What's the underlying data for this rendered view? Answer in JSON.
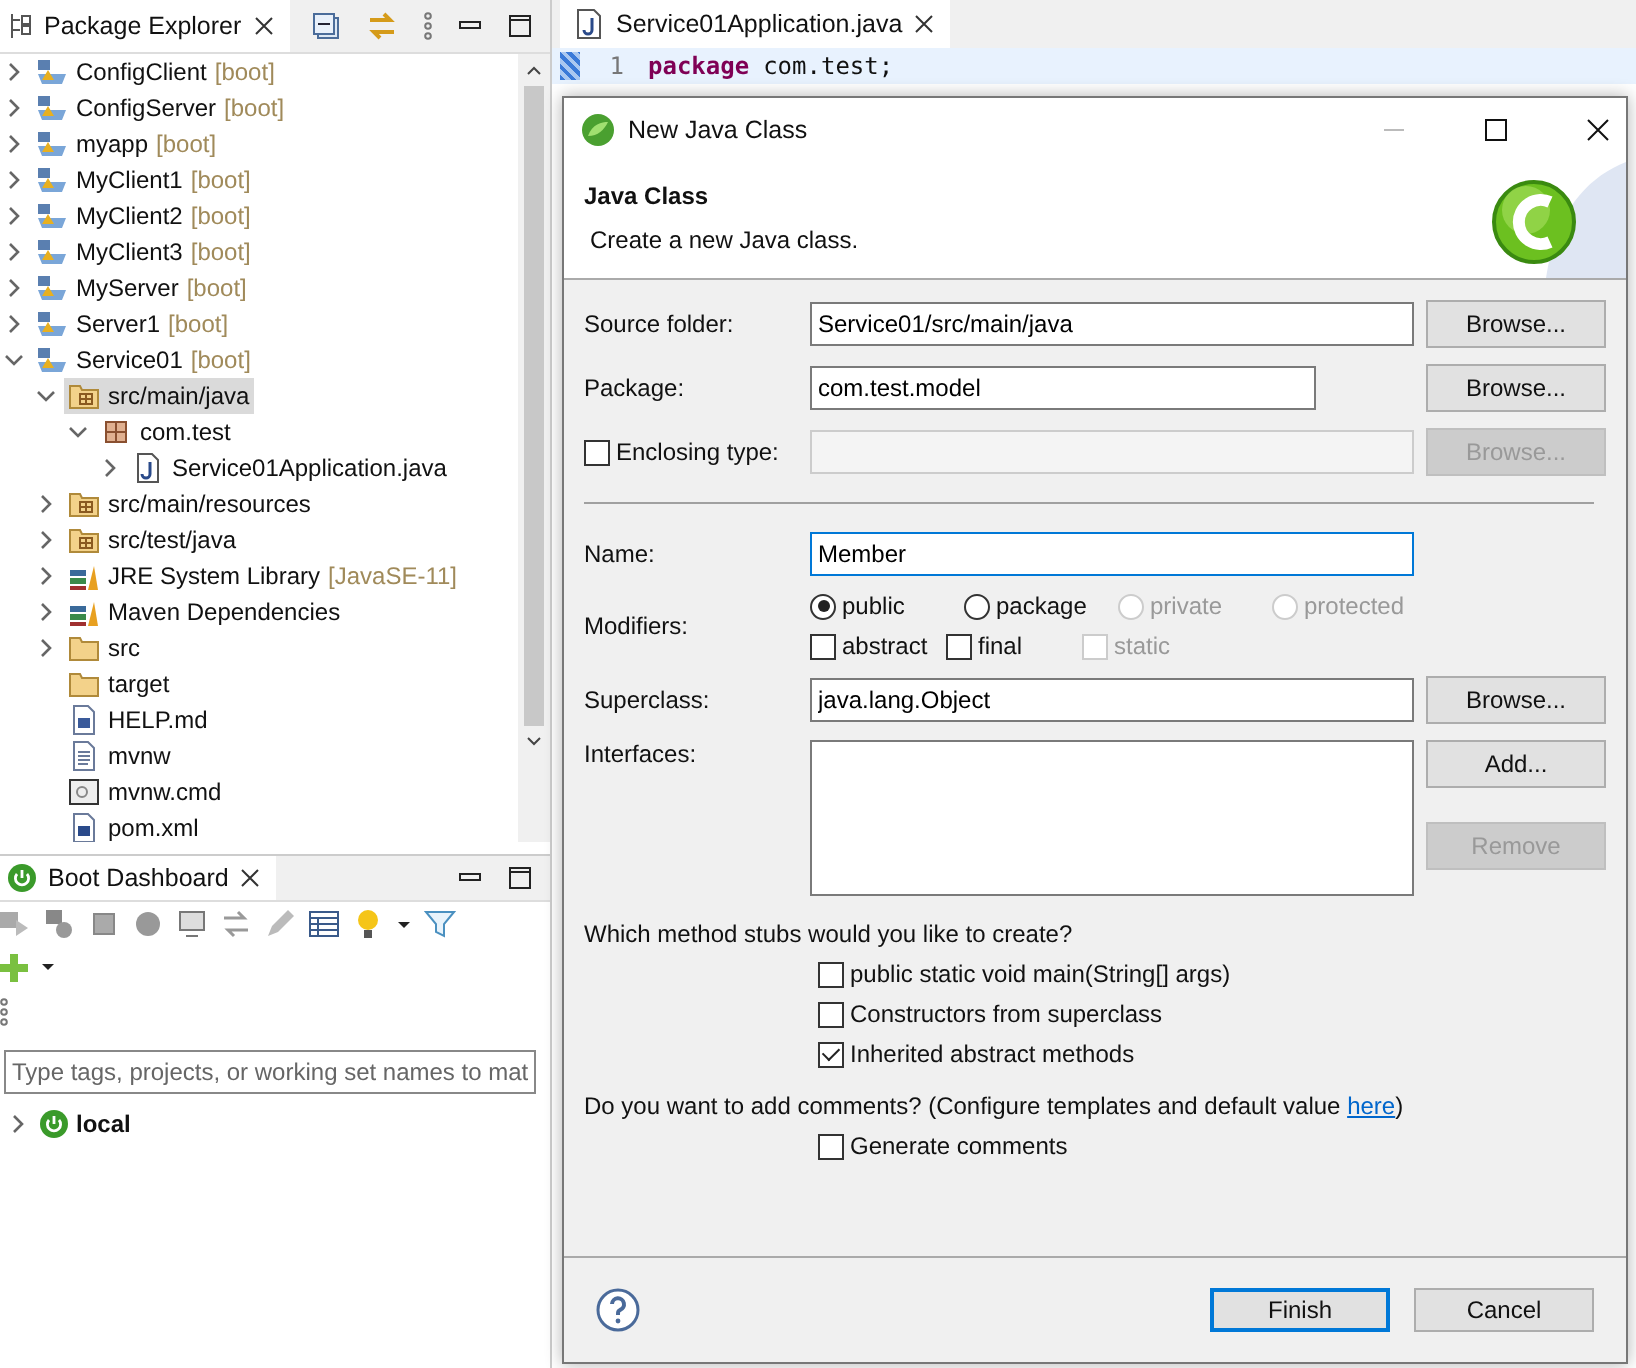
{
  "package_explorer": {
    "tab": "Package Explorer",
    "tree": [
      {
        "kind": "project",
        "label": "ConfigClient",
        "decoration": "[boot]",
        "expanded": false,
        "selected": false
      },
      {
        "kind": "project",
        "label": "ConfigServer",
        "decoration": "[boot]",
        "expanded": false,
        "selected": false
      },
      {
        "kind": "project",
        "label": "myapp",
        "decoration": "[boot]",
        "expanded": false,
        "selected": false
      },
      {
        "kind": "project",
        "label": "MyClient1",
        "decoration": "[boot]",
        "expanded": false,
        "selected": false
      },
      {
        "kind": "project",
        "label": "MyClient2",
        "decoration": "[boot]",
        "expanded": false,
        "selected": false
      },
      {
        "kind": "project",
        "label": "MyClient3",
        "decoration": "[boot]",
        "expanded": false,
        "selected": false
      },
      {
        "kind": "project",
        "label": "MyServer",
        "decoration": "[boot]",
        "expanded": false,
        "selected": false
      },
      {
        "kind": "project",
        "label": "Server1",
        "decoration": "[boot]",
        "expanded": false,
        "selected": false
      },
      {
        "kind": "project",
        "label": "Service01",
        "decoration": "[boot]",
        "expanded": true,
        "selected": false,
        "children": [
          {
            "kind": "source",
            "label": "src/main/java",
            "expanded": true,
            "selected": true,
            "children": [
              {
                "kind": "package",
                "label": "com.test",
                "expanded": true,
                "selected": false,
                "children": [
                  {
                    "kind": "java",
                    "label": "Service01Application.java",
                    "expanded": false,
                    "selected": false
                  }
                ]
              }
            ]
          },
          {
            "kind": "source",
            "label": "src/main/resources",
            "expanded": false,
            "selected": false
          },
          {
            "kind": "source",
            "label": "src/test/java",
            "expanded": false,
            "selected": false
          },
          {
            "kind": "library",
            "label": "JRE System Library",
            "decoration": "[JavaSE-11]",
            "expanded": false,
            "selected": false
          },
          {
            "kind": "library",
            "label": "Maven Dependencies",
            "expanded": false,
            "selected": false
          },
          {
            "kind": "folder",
            "label": "src",
            "expanded": false,
            "selected": false
          },
          {
            "kind": "folder",
            "label": "target",
            "selected": false
          },
          {
            "kind": "doc",
            "label": "HELP.md",
            "selected": false
          },
          {
            "kind": "text",
            "label": "mvnw",
            "selected": false
          },
          {
            "kind": "script",
            "label": "mvnw.cmd",
            "selected": false
          },
          {
            "kind": "maven",
            "label": "pom.xml",
            "selected": false
          }
        ]
      }
    ]
  },
  "boot_dashboard": {
    "tab": "Boot Dashboard",
    "filter": {
      "placeholder": "Type tags, projects, or working set names to mat"
    },
    "items": [
      {
        "label": "local",
        "expanded": false
      }
    ]
  },
  "editor": {
    "tab": "Service01Application.java",
    "lines": [
      {
        "number": "1",
        "keyword": "package",
        "code": "com.test;"
      }
    ]
  },
  "dialog": {
    "title": "New Java Class",
    "heading": "Java Class",
    "description": "Create a new Java class.",
    "source_folder": {
      "label": "Source folder:",
      "value": "Service01/src/main/java",
      "button": "Browse..."
    },
    "package": {
      "label": "Package:",
      "value": "com.test.model",
      "button": "Browse..."
    },
    "enclosing_type": {
      "label": "Enclosing type:",
      "checked": false,
      "button": "Browse...",
      "disabled": true
    },
    "name": {
      "label": "Name:",
      "value": "Member",
      "focused": true
    },
    "modifiers": {
      "label": "Modifiers:",
      "radios": [
        {
          "label": "public",
          "selected": true,
          "disabled": false
        },
        {
          "label": "package",
          "selected": false,
          "disabled": false
        },
        {
          "label": "private",
          "selected": false,
          "disabled": true
        },
        {
          "label": "protected",
          "selected": false,
          "disabled": true
        }
      ],
      "checkboxes": [
        {
          "label": "abstract",
          "checked": false,
          "disabled": false
        },
        {
          "label": "final",
          "checked": false,
          "disabled": false
        },
        {
          "label": "static",
          "checked": false,
          "disabled": true
        }
      ]
    },
    "superclass": {
      "label": "Superclass:",
      "value": "java.lang.Object",
      "button": "Browse..."
    },
    "interfaces": {
      "label": "Interfaces:",
      "buttons": [
        {
          "label": "Add...",
          "disabled": false
        },
        {
          "label": "Remove",
          "disabled": true
        }
      ]
    },
    "stubs": {
      "question": "Which method stubs would you like to create?",
      "options": [
        {
          "label": "public static void main(String[] args)",
          "checked": false
        },
        {
          "label": "Constructors from superclass",
          "checked": false
        },
        {
          "label": "Inherited abstract methods",
          "checked": true
        }
      ]
    },
    "comments": {
      "question": "Do you want to add comments? (Configure templates and default value ",
      "link": "here",
      "after": ")",
      "option": {
        "label": "Generate comments",
        "checked": false
      }
    },
    "buttons": [
      {
        "label": "Finish",
        "default": true
      },
      {
        "label": "Cancel",
        "default": false
      }
    ]
  }
}
